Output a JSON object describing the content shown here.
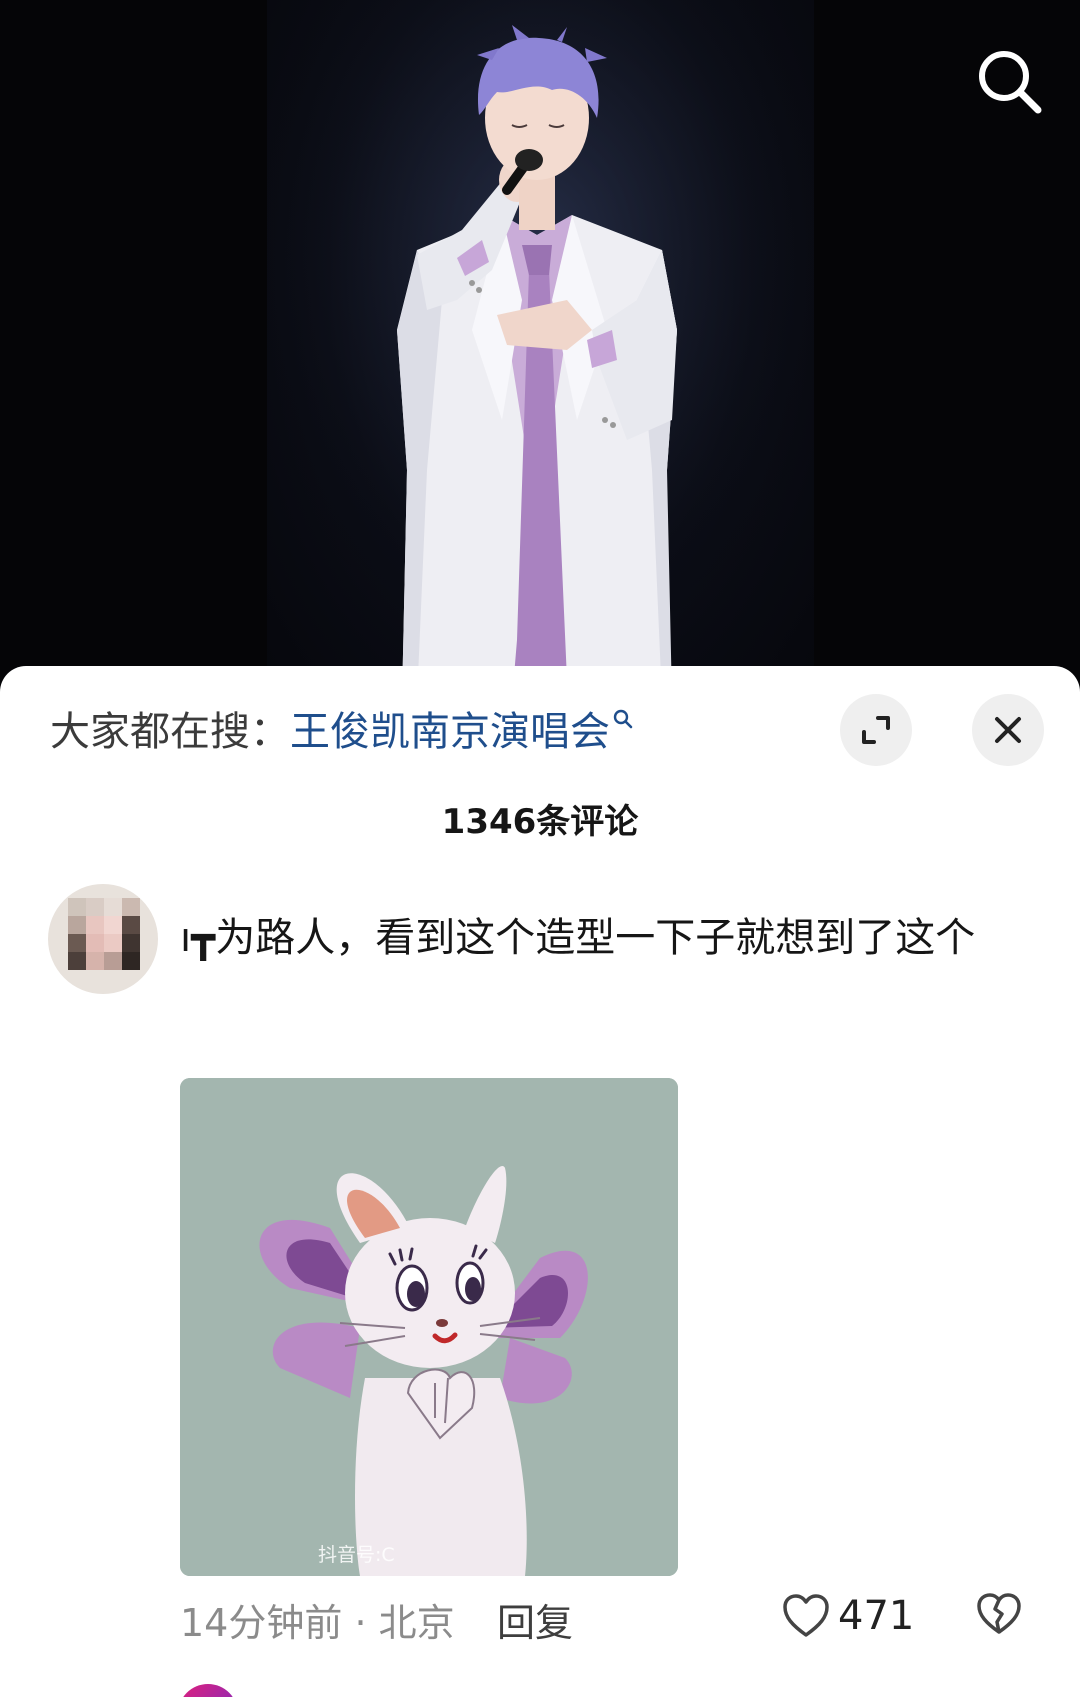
{
  "search_bar": {
    "prefix": "大家都在搜：",
    "query": "王俊凯南京演唱会"
  },
  "comments": {
    "count_label": "1346条评论"
  },
  "comment": {
    "text": "ı┳为路人，看到这个造型一下子就想到了这个",
    "image_watermark": "抖音号:C",
    "time": "14分钟前",
    "location": "北京",
    "meta_separator": " · ",
    "reply_label": "回复",
    "like_count": "471"
  },
  "icons": {
    "search": "search-icon",
    "expand": "expand-icon",
    "close": "close-icon",
    "like": "heart-outline-icon",
    "dislike": "broken-heart-icon"
  },
  "colors": {
    "accent_link": "#1f4e8c",
    "sheet_bg": "#ffffff",
    "video_bg": "#050507"
  }
}
